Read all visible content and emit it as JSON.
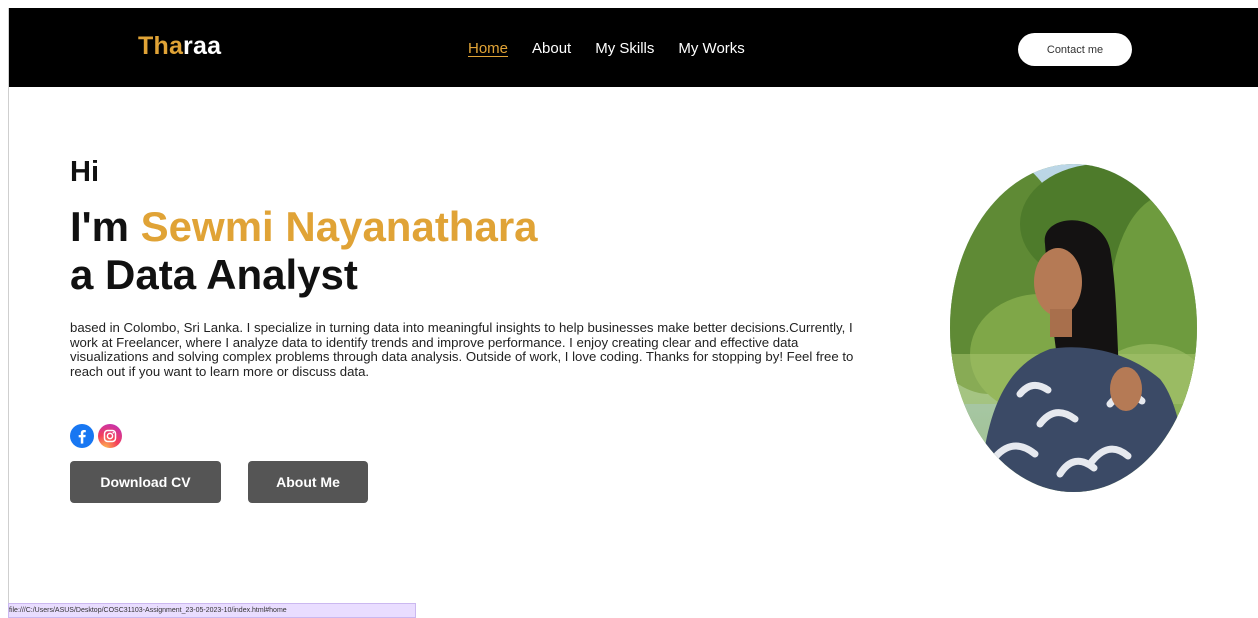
{
  "navbar": {
    "logo_accent": "Tha",
    "logo_rest": "raa",
    "links": [
      {
        "label": "Home",
        "active": true
      },
      {
        "label": "About"
      },
      {
        "label": "My Skills"
      },
      {
        "label": "My Works"
      }
    ],
    "contact_label": "Contact me"
  },
  "hero": {
    "greeting": "Hi",
    "im": "I'm ",
    "name": "Sewmi Nayanathara",
    "role": "a Data Analyst",
    "bio": "based in Colombo, Sri Lanka. I specialize in turning data into meaningful insights to help businesses make better decisions.Currently, I work at Freelancer, where I analyze data to identify trends and improve performance. I enjoy creating clear and effective data visualizations and solving complex problems through data analysis. Outside of work, I love coding. Thanks for stopping by! Feel free to reach out if you want to learn more or discuss data."
  },
  "socials": [
    {
      "icon": "facebook-icon",
      "color": "#1877f2"
    },
    {
      "icon": "instagram-icon",
      "color": "#e1306c"
    }
  ],
  "buttons": {
    "download_cv": "Download CV",
    "about_me": "About Me"
  },
  "status_url": "file:///C:/Users/ASUS/Desktop/COSC31103-Assignment_23-05-2023-10/index.html#home",
  "colors": {
    "accent": "#e0a336",
    "navbar_bg": "#000000",
    "button_bg": "#555555"
  }
}
